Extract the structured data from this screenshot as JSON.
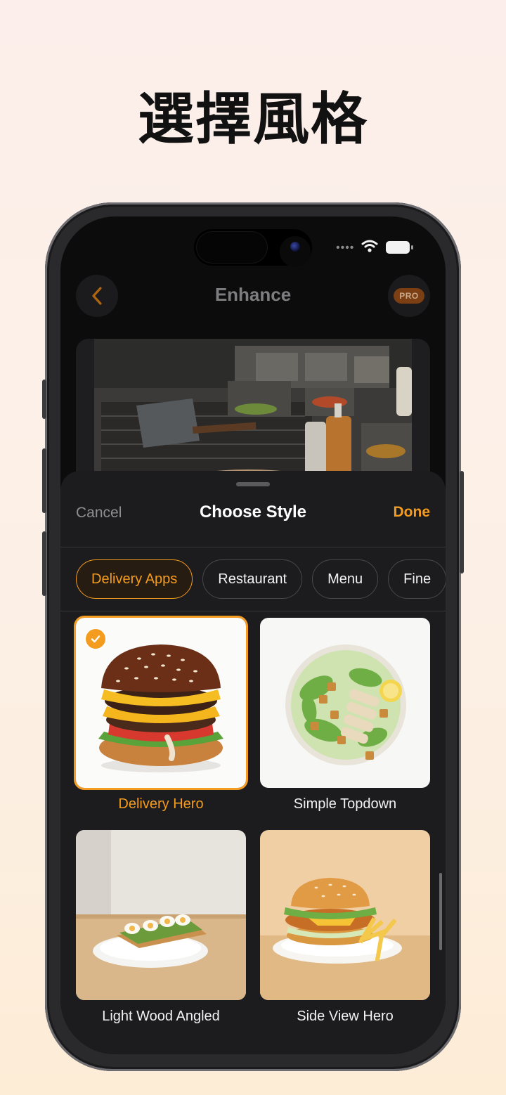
{
  "headline": "選擇風格",
  "status": {
    "signal_icon": "dots-icon",
    "wifi_icon": "wifi-icon",
    "battery_icon": "battery-icon"
  },
  "nav": {
    "back_icon": "chevron-left-icon",
    "title": "Enhance",
    "pro_label": "PRO"
  },
  "sheet": {
    "cancel_label": "Cancel",
    "title": "Choose Style",
    "done_label": "Done",
    "chips": [
      {
        "label": "Delivery Apps",
        "active": true
      },
      {
        "label": "Restaurant",
        "active": false
      },
      {
        "label": "Menu",
        "active": false
      },
      {
        "label": "Fine",
        "active": false
      }
    ],
    "styles": [
      {
        "label": "Delivery Hero",
        "selected": true
      },
      {
        "label": "Simple Topdown",
        "selected": false
      },
      {
        "label": "Light Wood Angled",
        "selected": false
      },
      {
        "label": "Side View Hero",
        "selected": false
      }
    ]
  },
  "colors": {
    "accent": "#f39c1f",
    "sheet_bg": "#1c1c1e",
    "page_bg": "#fcefeb"
  }
}
